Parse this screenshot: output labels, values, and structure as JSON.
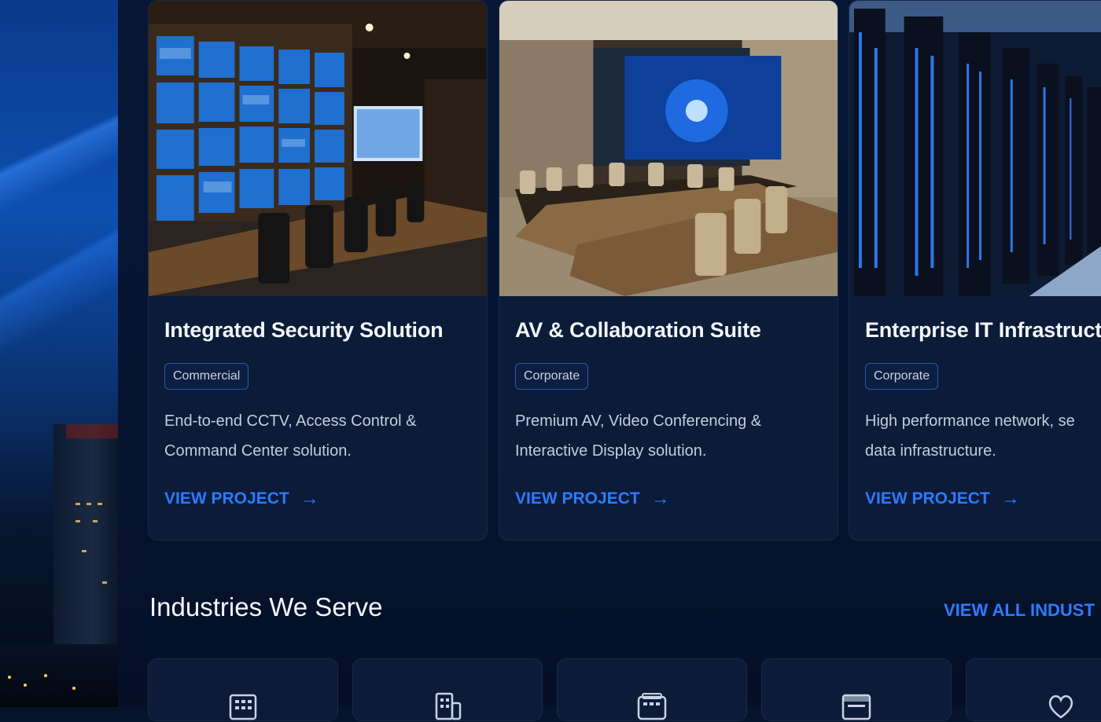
{
  "projects": [
    {
      "title": "Integrated Security Solution",
      "tag": "Commercial",
      "desc_line1": "End-to-end CCTV, Access Control &",
      "desc_line2": "Command Center solution.",
      "cta": "VIEW PROJECT",
      "image": "security-control-room-photo"
    },
    {
      "title": "AV & Collaboration Suite",
      "tag": "Corporate",
      "desc_line1": "Premium AV, Video Conferencing &",
      "desc_line2": "Interactive Display solution.",
      "cta": "VIEW PROJECT",
      "image": "conference-room-photo"
    },
    {
      "title": "Enterprise IT Infrastructure",
      "tag": "Corporate",
      "desc_line1": "High performance network, se",
      "desc_line2": "data infrastructure.",
      "cta": "VIEW PROJECT",
      "image": "server-room-photo"
    }
  ],
  "industries": {
    "title": "Industries We Serve",
    "view_all": "VIEW ALL INDUST",
    "icons": [
      "building-icon",
      "office-icon",
      "hospital-icon",
      "store-icon",
      "heart-icon"
    ]
  },
  "colors": {
    "background": "#06132b",
    "card": "#0b1b38",
    "accent": "#2d7bff",
    "tag_border": "#2a5bb0",
    "text": "#f3f6fb",
    "muted": "#c3cddd"
  }
}
